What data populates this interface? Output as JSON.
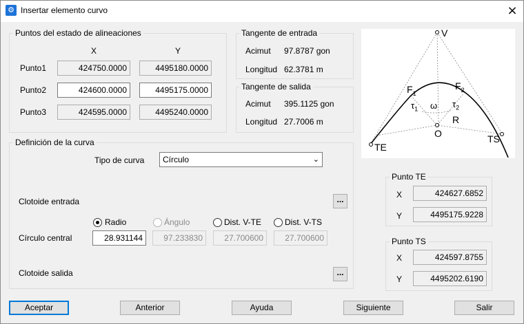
{
  "window": {
    "title": "Insertar elemento curvo",
    "close_icon": "×",
    "app_icon": "gear-icon"
  },
  "alineaciones": {
    "legend": "Puntos del estado de alineaciones",
    "col_x": "X",
    "col_y": "Y",
    "rows": [
      {
        "label": "Punto1",
        "x": "424750.0000",
        "y": "4495180.0000"
      },
      {
        "label": "Punto2",
        "x": "424600.0000",
        "y": "4495175.0000"
      },
      {
        "label": "Punto3",
        "x": "424595.0000",
        "y": "4495240.0000"
      }
    ]
  },
  "tangente_entrada": {
    "legend": "Tangente de entrada",
    "acimut_label": "Acimut",
    "acimut": "97.8787 gon",
    "longitud_label": "Longitud",
    "longitud": "62.3781 m"
  },
  "tangente_salida": {
    "legend": "Tangente de salida",
    "acimut_label": "Acimut",
    "acimut": "395.1125 gon",
    "longitud_label": "Longitud",
    "longitud": "27.7006 m"
  },
  "curva": {
    "legend": "Definición de la curva",
    "tipo_label": "Tipo de curva",
    "tipo_value": "Círculo",
    "clotoide_entrada": "Clotoide entrada",
    "circulo_central": "Círculo central",
    "clotoide_salida": "Clotoide salida",
    "dots": "...",
    "radio": {
      "label": "Radio",
      "value": "28.931144"
    },
    "angulo": {
      "label": "Ángulo",
      "value": "97.233830"
    },
    "dist_vte": {
      "label": "Dist. V-TE",
      "value": "27.700600"
    },
    "dist_vts": {
      "label": "Dist. V-TS",
      "value": "27.700600"
    }
  },
  "diagram": {
    "V": "V",
    "F1": "F",
    "F1_sub": "1",
    "F2": "F",
    "F2_sub": "2",
    "tau1": "τ",
    "tau1_sub": "1",
    "tau2": "τ",
    "tau2_sub": "2",
    "omega": "ω",
    "R": "R",
    "O": "O",
    "TE": "TE",
    "TS": "TS"
  },
  "punto_te": {
    "legend": "Punto TE",
    "x_label": "X",
    "x": "424627.6852",
    "y_label": "Y",
    "y": "4495175.9228"
  },
  "punto_ts": {
    "legend": "Punto TS",
    "x_label": "X",
    "x": "424597.8755",
    "y_label": "Y",
    "y": "4495202.6190"
  },
  "buttons": {
    "aceptar": "Aceptar",
    "anterior": "Anterior",
    "ayuda": "Ayuda",
    "siguiente": "Siguiente",
    "salir": "Salir"
  }
}
